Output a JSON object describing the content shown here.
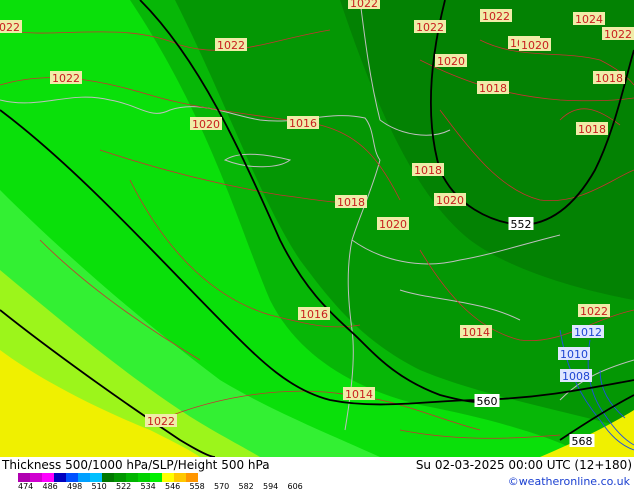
{
  "map": {
    "slp_labels_red": [
      "1022",
      "1022",
      "1022",
      "1022",
      "1024",
      "1020",
      "1022",
      "1022",
      "1020",
      "1020",
      "1022",
      "1018",
      "1018",
      "1020",
      "1016",
      "1018",
      "1018",
      "1018",
      "1020",
      "1020",
      "1016",
      "1014",
      "1022",
      "1014",
      "1022"
    ],
    "slp_labels_blue": [
      "1012",
      "1010",
      "1008"
    ],
    "height_labels": [
      "552",
      "560",
      "568"
    ]
  },
  "footer": {
    "title": "Thickness 500/1000 hPa/SLP/Height 500 hPa",
    "valid": "Su 02-03-2025 00:00 UTC (12+180)",
    "credit": "©weatheronline.co.uk",
    "scale_ticks": [
      "474",
      "486",
      "498",
      "510",
      "522",
      "534",
      "546",
      "558",
      "570",
      "582",
      "594",
      "606"
    ],
    "scale_colors": [
      "#b000b0",
      "#d000d0",
      "#ff00ff",
      "#0000c0",
      "#0050ff",
      "#00a0ff",
      "#00c0ff",
      "#007800",
      "#009600",
      "#00b400",
      "#00d200",
      "#00f000",
      "#ffff00",
      "#ffc800",
      "#ff9600"
    ]
  }
}
